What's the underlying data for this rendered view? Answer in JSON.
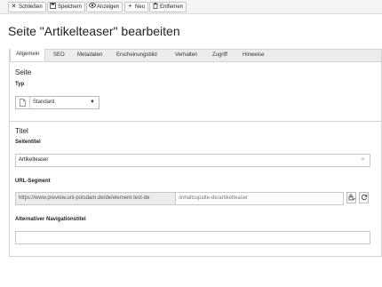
{
  "toolbar": {
    "close": {
      "label": "Schließen",
      "icon": "close-icon"
    },
    "save": {
      "label": "Speichern",
      "icon": "save-icon"
    },
    "view": {
      "label": "Anzeigen",
      "icon": "eye-icon"
    },
    "new": {
      "label": "Neu",
      "icon": "plus-icon"
    },
    "delete": {
      "label": "Entfernen",
      "icon": "trash-icon"
    }
  },
  "page": {
    "title": "Seite \"Artikelteaser\" bearbeiten"
  },
  "tabs": [
    "Allgemein",
    "SEO",
    "Metadaten",
    "Erscheinungsbild",
    "Verhalten",
    "Zugriff",
    "Hinweise"
  ],
  "active_tab": "Allgemein",
  "section_page": {
    "title": "Seite",
    "type_label": "Typ",
    "type_value": "Standard"
  },
  "section_title": {
    "title": "Titel",
    "page_title_label": "Seitentitel",
    "page_title_value": "Artikelteaser",
    "url_label": "URL-Segment",
    "url_base": "https://www.preview.uni-potsdam.de/de/element-test-de",
    "url_segment": "/inhaltsspalte-de/artikelteaser",
    "nav_title_label": "Alternativer Navigationstitel",
    "nav_title_value": ""
  }
}
